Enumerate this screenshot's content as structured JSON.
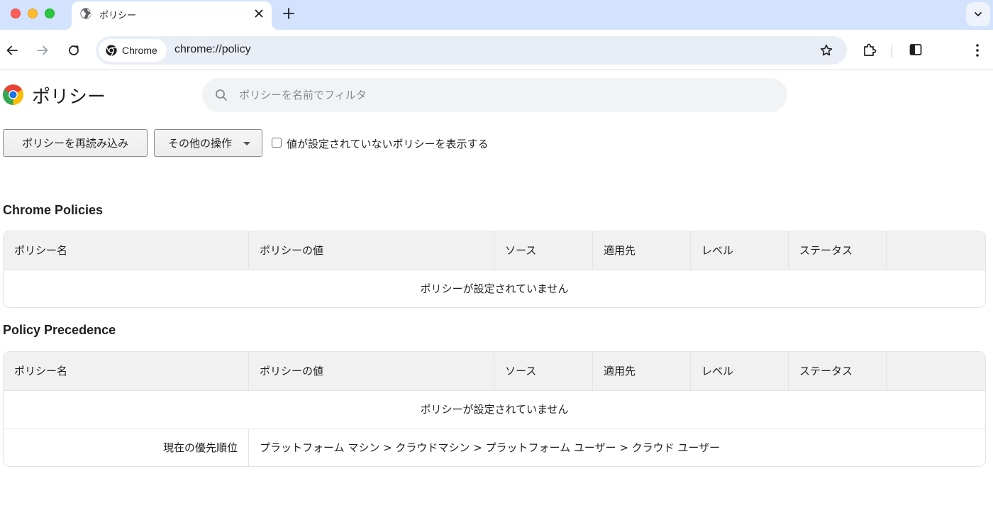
{
  "browser": {
    "tab": {
      "title": "ポリシー",
      "icon": "globe-icon"
    },
    "omnibox": {
      "chip_label": "Chrome",
      "url": "chrome://policy"
    }
  },
  "page": {
    "title": "ポリシー",
    "filter_placeholder": "ポリシーを名前でフィルタ",
    "reload_button": "ポリシーを再読み込み",
    "more_actions_button": "その他の操作",
    "show_unset_label": "値が設定されていないポリシーを表示する",
    "show_unset_checked": false
  },
  "columns": [
    "ポリシー名",
    "ポリシーの値",
    "ソース",
    "適用先",
    "レベル",
    "ステータス",
    ""
  ],
  "sections": [
    {
      "title": "Chrome Policies",
      "empty_message": "ポリシーが設定されていません"
    },
    {
      "title": "Policy Precedence",
      "empty_message": "ポリシーが設定されていません",
      "precedence_label": "現在の優先順位",
      "precedence_value": "プラットフォーム マシン > クラウドマシン > プラットフォーム ユーザー > クラウド ユーザー"
    }
  ],
  "colors": {
    "tabstrip_bg": "#d3e3fd",
    "omnibox_bg": "#e9eef6",
    "table_header_bg": "#f1f1f1"
  }
}
